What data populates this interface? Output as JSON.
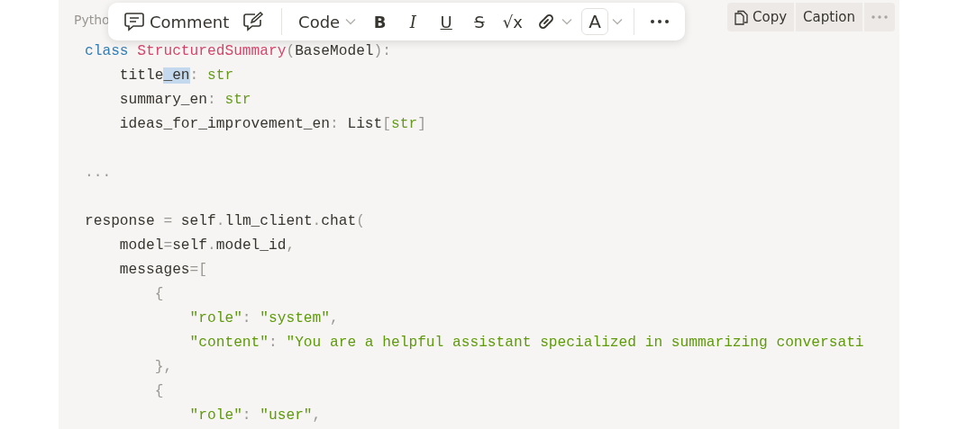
{
  "code_block": {
    "language": "Pytho",
    "actions": [
      {
        "kind": "copy",
        "label": "Copy"
      },
      {
        "kind": "caption",
        "label": "Caption"
      },
      {
        "kind": "more"
      }
    ],
    "lines": [
      {
        "tokens": [
          {
            "text": "class",
            "kind": "keyword"
          },
          {
            "text": " StructuredSummary",
            "kind": "class"
          },
          {
            "text": "(",
            "kind": "punct"
          },
          {
            "text": "BaseModel",
            "kind": "plain"
          },
          {
            "text": "):",
            "kind": "punct"
          }
        ]
      },
      {
        "tokens": [
          {
            "text": "    title",
            "kind": "plain"
          },
          {
            "text": "_en",
            "kind": "selection"
          },
          {
            "text": ": ",
            "kind": "punct"
          },
          {
            "text": "str",
            "kind": "type"
          }
        ]
      },
      {
        "tokens": [
          {
            "text": "    summary_en",
            "kind": "plain"
          },
          {
            "text": ": ",
            "kind": "punct"
          },
          {
            "text": "str",
            "kind": "type"
          }
        ]
      },
      {
        "tokens": [
          {
            "text": "    ideas_for_improvement_en",
            "kind": "plain"
          },
          {
            "text": ": ",
            "kind": "punct"
          },
          {
            "text": "List",
            "kind": "plain"
          },
          {
            "text": "[",
            "kind": "punct"
          },
          {
            "text": "str",
            "kind": "type"
          },
          {
            "text": "]",
            "kind": "punct"
          }
        ]
      },
      {
        "kind": "blank"
      },
      {
        "tokens": [
          {
            "text": "...",
            "kind": "punct"
          }
        ]
      },
      {
        "kind": "blank"
      },
      {
        "tokens": [
          {
            "text": "response ",
            "kind": "plain"
          },
          {
            "text": "=",
            "kind": "punct"
          },
          {
            "text": " self",
            "kind": "plain"
          },
          {
            "text": ".",
            "kind": "punct"
          },
          {
            "text": "llm_client",
            "kind": "plain"
          },
          {
            "text": ".",
            "kind": "punct"
          },
          {
            "text": "chat",
            "kind": "plain"
          },
          {
            "text": "(",
            "kind": "punct"
          }
        ]
      },
      {
        "tokens": [
          {
            "text": "    model",
            "kind": "plain"
          },
          {
            "text": "=",
            "kind": "punct"
          },
          {
            "text": "self",
            "kind": "plain"
          },
          {
            "text": ".",
            "kind": "punct"
          },
          {
            "text": "model_id",
            "kind": "plain"
          },
          {
            "text": ",",
            "kind": "punct"
          }
        ]
      },
      {
        "tokens": [
          {
            "text": "    messages",
            "kind": "plain"
          },
          {
            "text": "=[",
            "kind": "punct"
          }
        ]
      },
      {
        "tokens": [
          {
            "text": "        {",
            "kind": "punct"
          }
        ]
      },
      {
        "tokens": [
          {
            "text": "            \"role\"",
            "kind": "string"
          },
          {
            "text": ": ",
            "kind": "punct"
          },
          {
            "text": "\"system\"",
            "kind": "string"
          },
          {
            "text": ",",
            "kind": "punct"
          }
        ]
      },
      {
        "tokens": [
          {
            "text": "            \"content\"",
            "kind": "string"
          },
          {
            "text": ": ",
            "kind": "punct"
          },
          {
            "text": "\"You are a helpful assistant specialized in summarizing conversati",
            "kind": "string"
          }
        ]
      },
      {
        "tokens": [
          {
            "text": "        },",
            "kind": "punct"
          }
        ]
      },
      {
        "tokens": [
          {
            "text": "        {",
            "kind": "punct"
          }
        ]
      },
      {
        "tokens": [
          {
            "text": "            \"role\"",
            "kind": "string"
          },
          {
            "text": ": ",
            "kind": "punct"
          },
          {
            "text": "\"user\"",
            "kind": "string"
          },
          {
            "text": ",",
            "kind": "punct"
          }
        ]
      }
    ]
  },
  "toolbar": {
    "items": [
      {
        "kind": "comment",
        "label": "Comment"
      },
      {
        "kind": "edit"
      },
      {
        "kind": "divider"
      },
      {
        "kind": "dropdown",
        "label": "Code"
      },
      {
        "kind": "bold",
        "label": "B"
      },
      {
        "kind": "italic",
        "label": "I"
      },
      {
        "kind": "underline",
        "label": "U"
      },
      {
        "kind": "strike",
        "label": "S"
      },
      {
        "kind": "math",
        "label": "√x"
      },
      {
        "kind": "link"
      },
      {
        "kind": "color",
        "label": "A"
      },
      {
        "kind": "divider"
      },
      {
        "kind": "more"
      }
    ]
  }
}
